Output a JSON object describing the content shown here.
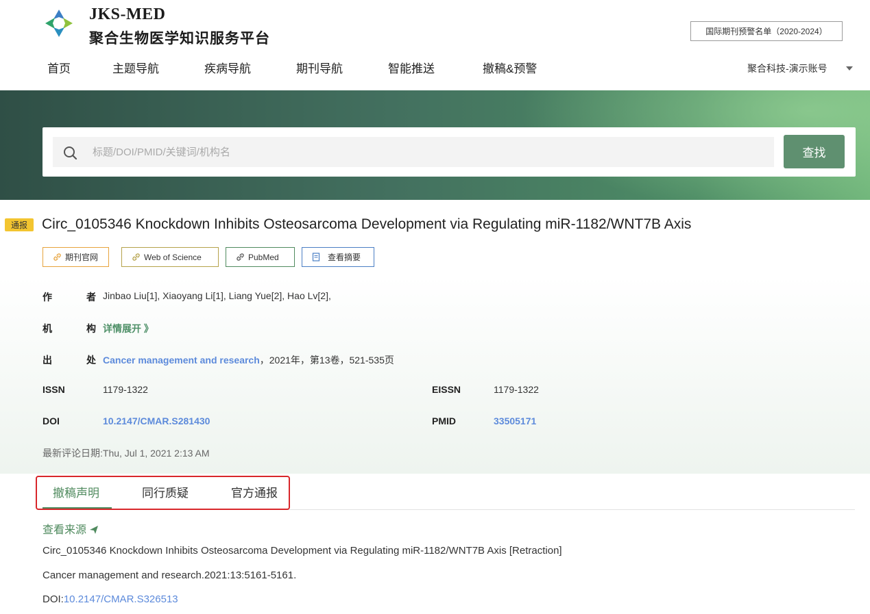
{
  "header": {
    "logo_title": "JKS-MED",
    "logo_subtitle": "聚合生物医学知识服务平台",
    "warning_list_button": "国际期刊预警名单（2020-2024）",
    "account": "聚合科技-演示账号"
  },
  "nav": {
    "items": [
      "首页",
      "主题导航",
      "疾病导航",
      "期刊导航",
      "智能推送",
      "撤稿&预警"
    ]
  },
  "search": {
    "placeholder": "标题/DOI/PMID/关键词/机构名",
    "value": "",
    "button_label": "查找"
  },
  "article": {
    "badge": "通报",
    "title": "Circ_0105346 Knockdown Inhibits Osteosarcoma Development via Regulating miR-1182/WNT7B Axis",
    "links": {
      "journal_site": "期刊官网",
      "web_of_science": "Web of Science",
      "pubmed": "PubMed",
      "abstract": "查看摘要"
    },
    "authors_label_1": "作",
    "authors_label_2": "者",
    "authors": "Jinbao Liu[1],  Xiaoyang Li[1],  Liang Yue[2],  Hao Lv[2],",
    "institution_label_1": "机",
    "institution_label_2": "构",
    "institution_expand": "详情展开 》",
    "source_label_1": "出",
    "source_label_2": "处",
    "source_journal": "Cancer management and research",
    "source_detail": "，2021年，第13卷，521-535页",
    "issn_label": "ISSN",
    "issn": "1179-1322",
    "eissn_label": "EISSN",
    "eissn": "1179-1322",
    "doi_label": "DOI",
    "doi": "10.2147/CMAR.S281430",
    "pmid_label": "PMID",
    "pmid": "33505171",
    "latest_comment": "最新评论日期:Thu, Jul 1, 2021 2:13 AM"
  },
  "tabs": {
    "items": [
      "撤稿声明",
      "同行质疑",
      "官方通报"
    ],
    "active": 0
  },
  "retraction": {
    "source_label": "查看来源",
    "ref_title": "Circ_0105346 Knockdown Inhibits Osteosarcoma Development via Regulating miR-1182/WNT7B Axis [Retraction]",
    "ref_citation": "Cancer management and research.2021:13:5161-5161.",
    "doi_prefix": "DOI:",
    "doi": "10.2147/CMAR.S326513"
  },
  "colors": {
    "accent_green": "#4f8a5e",
    "link_blue": "#5c8adb",
    "badge_yellow": "#f3c530",
    "highlight_red": "#d8262a"
  }
}
